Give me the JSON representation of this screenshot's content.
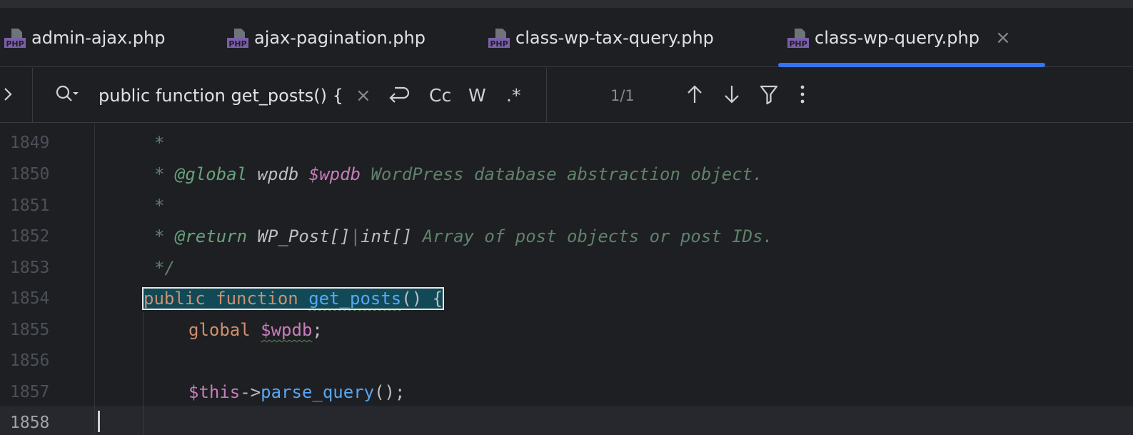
{
  "tabs": [
    {
      "label": "admin-ajax.php",
      "icon": "php-file-icon",
      "active": false
    },
    {
      "label": "ajax-pagination.php",
      "icon": "php-file-icon",
      "active": false
    },
    {
      "label": "class-wp-tax-query.php",
      "icon": "php-file-icon",
      "active": false
    },
    {
      "label": "class-wp-query.php",
      "icon": "php-file-icon",
      "active": true
    }
  ],
  "tab_close_glyph": "×",
  "search": {
    "query": "public function get_posts() {",
    "clear_glyph": "×",
    "match_case_label": "Cc",
    "words_label": "W",
    "regex_label": ".*",
    "result_count": "1/1"
  },
  "editor": {
    "lines": [
      {
        "num": "1849"
      },
      {
        "num": "1850"
      },
      {
        "num": "1851"
      },
      {
        "num": "1852"
      },
      {
        "num": "1853"
      },
      {
        "num": "1854"
      },
      {
        "num": "1855"
      },
      {
        "num": "1856"
      },
      {
        "num": "1857"
      },
      {
        "num": "1858"
      }
    ],
    "tokens": {
      "star": "*",
      "at_global": "@global",
      "global_type": "wpdb",
      "global_var": "$wpdb",
      "global_desc": "WordPress database abstraction object.",
      "at_return": "@return",
      "return_type1": "WP_Post[]",
      "pipe": "|",
      "return_type2": "int[]",
      "return_desc": "Array of post objects or post IDs.",
      "close_comment": "*/",
      "kw_public": "public",
      "kw_function": "function",
      "fn_get_posts": "get_posts",
      "parens_brace": "() {",
      "kw_global": "global",
      "var_wpdb": "$wpdb",
      "semi": ";",
      "var_this": "$this",
      "arrow": "->",
      "fn_parse_query": "parse_query",
      "call_end": "();"
    }
  },
  "colors": {
    "accent": "#3574f0",
    "keyword": "#cf8e6d",
    "function": "#56a8f5",
    "variable": "#c77dbb",
    "comment": "#5f826b",
    "doc_tag": "#67a37c",
    "match_bg": "#114957"
  }
}
